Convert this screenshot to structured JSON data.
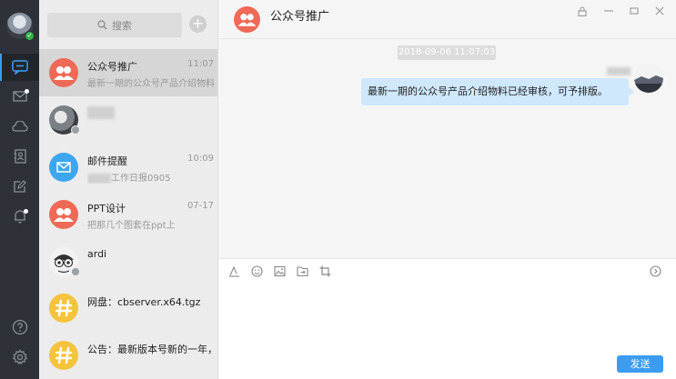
{
  "search": {
    "placeholder": "搜索"
  },
  "sessions": [
    {
      "name": "公众号推广",
      "time": "11:07",
      "preview": "最新一期的公众号产品介绍物料已经审核，可予排版。"
    },
    {
      "name": "",
      "time": "",
      "preview": ""
    },
    {
      "name": "邮件提醒",
      "time": "10:09",
      "preview": "工作日报0905"
    },
    {
      "name": "PPT设计",
      "time": "07-17",
      "preview": "把那几个图套在ppt上"
    },
    {
      "name": "ardi",
      "time": "",
      "preview": ""
    },
    {
      "name": "网盘：cbserver.x64.tgz",
      "time": "",
      "preview": ""
    },
    {
      "name": "公告：最新版本号新的一年，愿你这一年",
      "time": "",
      "preview": ""
    }
  ],
  "chat": {
    "title": "公众号推广",
    "timestamp": "2018-09-06 11:07:03",
    "message": "最新一期的公众号产品介绍物料已经审核，可予排版。"
  },
  "composer": {
    "send_label": "发送"
  },
  "colors": {
    "accent": "#3c9df0",
    "rail": "#2e3238",
    "bubble": "#cfe8fb",
    "official": "#ee6a57"
  }
}
